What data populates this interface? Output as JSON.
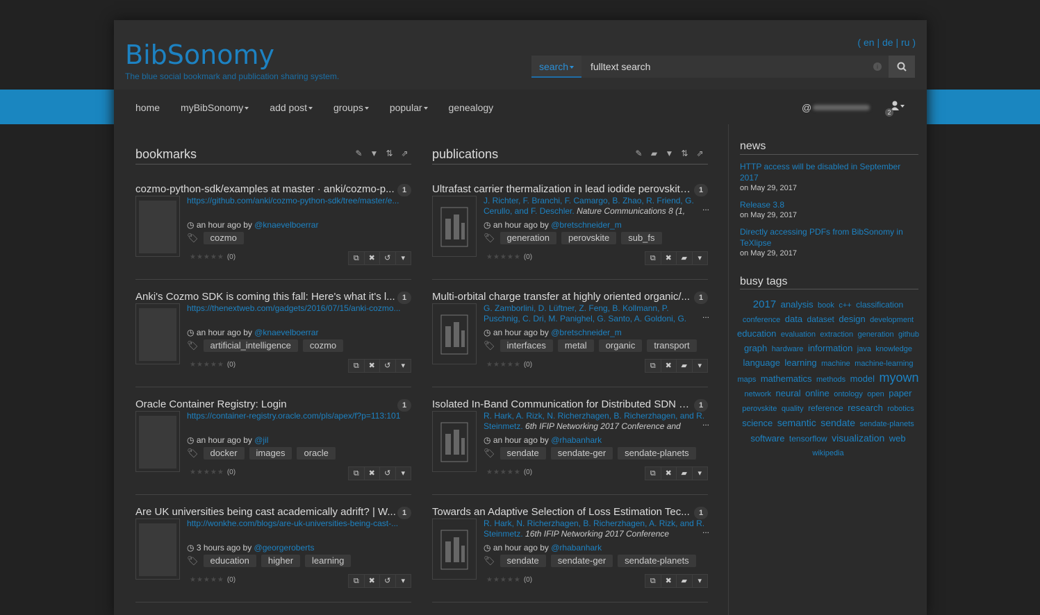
{
  "header": {
    "brand": "BibSonomy",
    "tagline": "The blue social bookmark and publication sharing system.",
    "langs": [
      "en",
      "de",
      "ru"
    ],
    "search": {
      "select_label": "search",
      "placeholder": "fulltext search"
    }
  },
  "nav": {
    "items": [
      {
        "label": "home",
        "dropdown": false
      },
      {
        "label": "myBibSonomy",
        "dropdown": true
      },
      {
        "label": "add post",
        "dropdown": true
      },
      {
        "label": "groups",
        "dropdown": true
      },
      {
        "label": "popular",
        "dropdown": true
      },
      {
        "label": "genealogy",
        "dropdown": false
      }
    ],
    "user_prefix": "@",
    "user_badge": "2"
  },
  "bookmarks": {
    "title": "bookmarks",
    "posts": [
      {
        "title": "cozmo-python-sdk/examples at master · anki/cozmo-p...",
        "count": "1",
        "url": "https://github.com/anki/cozmo-python-sdk/tree/master/e...",
        "time": "an hour ago by",
        "user": "@knaevelboerrar",
        "tags": [
          "cozmo"
        ],
        "rating": "(0)"
      },
      {
        "title": "Anki's Cozmo SDK is coming this fall: Here's what it's l...",
        "count": "1",
        "url": "https://thenextweb.com/gadgets/2016/07/15/anki-cozmo...",
        "time": "an hour ago by",
        "user": "@knaevelboerrar",
        "tags": [
          "artificial_intelligence",
          "cozmo"
        ],
        "rating": "(0)"
      },
      {
        "title": "Oracle Container Registry: Login",
        "count": "1",
        "url": "https://container-registry.oracle.com/pls/apex/f?p=113:101",
        "time": "an hour ago by",
        "user": "@jil",
        "tags": [
          "docker",
          "images",
          "oracle"
        ],
        "rating": "(0)"
      },
      {
        "title": "Are UK universities being cast academically adrift? | W...",
        "count": "1",
        "url": "http://wonkhe.com/blogs/are-uk-universities-being-cast-...",
        "time": "3 hours ago by",
        "user": "@georgeroberts",
        "tags": [
          "education",
          "higher",
          "learning"
        ],
        "rating": "(0)"
      }
    ]
  },
  "publications": {
    "title": "publications",
    "posts": [
      {
        "title": "Ultrafast carrier thermalization in lead iodide perovskite ...",
        "count": "1",
        "authors": "J. Richter, F. Branchi, F. Camargo, B. Zhao, R. Friend, G. Cerullo, and F. Deschler.",
        "venue": "Nature Communications 8 (1,",
        "time": "an hour ago by",
        "user": "@bretschneider_m",
        "tags": [
          "generation",
          "perovskite",
          "sub_fs"
        ],
        "rating": "(0)"
      },
      {
        "title": "Multi-orbital charge transfer at highly oriented organic/...",
        "count": "1",
        "authors": "G. Zamborlini, D. Lüftner, Z. Feng, B. Kollmann, P. Puschnig, C. Dri, M. Panighel, G. Santo, A. Goldoni, G. Comelli, M",
        "venue": "",
        "time": "an hour ago by",
        "user": "@bretschneider_m",
        "tags": [
          "interfaces",
          "metal",
          "organic",
          "transport"
        ],
        "rating": "(0)"
      },
      {
        "title": "Isolated In-Band Communication for Distributed SDN C...",
        "count": "1",
        "authors": "R. Hark, A. Rizk, N. Richerzhagen, B. Richerzhagen, and R. Steinmetz.",
        "venue": "6th IFIP Networking 2017 Conference and",
        "time": "an hour ago by",
        "user": "@rhabanhark",
        "tags": [
          "sendate",
          "sendate-ger",
          "sendate-planets"
        ],
        "rating": "(0)"
      },
      {
        "title": "Towards an Adaptive Selection of Loss Estimation Tec...",
        "count": "1",
        "authors": "R. Hark, N. Richerzhagen, B. Richerzhagen, A. Rizk, and R. Steinmetz.",
        "venue": "16th IFIP Networking 2017 Conference",
        "time": "an hour ago by",
        "user": "@rhabanhark",
        "tags": [
          "sendate",
          "sendate-ger",
          "sendate-planets"
        ],
        "rating": "(0)"
      }
    ]
  },
  "sidebar": {
    "news_title": "news",
    "news": [
      {
        "title": "HTTP access will be disabled in September 2017",
        "date": "on May 29, 2017"
      },
      {
        "title": "Release 3.8",
        "date": "on May 29, 2017"
      },
      {
        "title": "Directly accessing PDFs from BibSonomy in TeXlipse",
        "date": "on May 29, 2017"
      }
    ],
    "tags_title": "busy tags",
    "tags": [
      [
        "2017",
        15
      ],
      [
        "analysis",
        13
      ],
      [
        "book",
        11
      ],
      [
        "c++",
        11
      ],
      [
        "classification",
        12
      ],
      [
        "conference",
        11
      ],
      [
        "data",
        13
      ],
      [
        "dataset",
        12
      ],
      [
        "design",
        13
      ],
      [
        "development",
        11
      ],
      [
        "education",
        13
      ],
      [
        "evaluation",
        11
      ],
      [
        "extraction",
        11
      ],
      [
        "generation",
        11
      ],
      [
        "github",
        11
      ],
      [
        "graph",
        13
      ],
      [
        "hardware",
        11
      ],
      [
        "information",
        13
      ],
      [
        "java",
        11
      ],
      [
        "knowledge",
        11
      ],
      [
        "language",
        13
      ],
      [
        "learning",
        13
      ],
      [
        "machine",
        11
      ],
      [
        "machine-learning",
        11
      ],
      [
        "maps",
        11
      ],
      [
        "mathematics",
        13
      ],
      [
        "methods",
        11
      ],
      [
        "model",
        13
      ],
      [
        "myown",
        18
      ],
      [
        "network",
        11
      ],
      [
        "neural",
        13
      ],
      [
        "online",
        13
      ],
      [
        "ontology",
        11
      ],
      [
        "open",
        11
      ],
      [
        "paper",
        13
      ],
      [
        "perovskite",
        11
      ],
      [
        "quality",
        11
      ],
      [
        "reference",
        12
      ],
      [
        "research",
        13
      ],
      [
        "robotics",
        11
      ],
      [
        "science",
        13
      ],
      [
        "semantic",
        14
      ],
      [
        "sendate",
        14
      ],
      [
        "sendate-planets",
        11
      ],
      [
        "software",
        13
      ],
      [
        "tensorflow",
        12
      ],
      [
        "visualization",
        14
      ],
      [
        "web",
        13
      ],
      [
        "wikipedia",
        11
      ]
    ]
  }
}
